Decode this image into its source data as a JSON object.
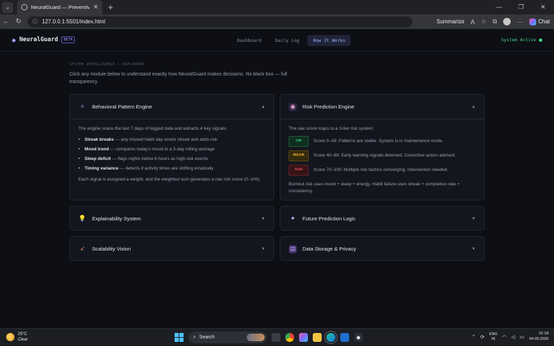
{
  "browser": {
    "tab_title": "NeuralGuard — Preventive Health",
    "url": "127.0.0.1:5501/index.html",
    "summarize_label": "Summarize",
    "chat_label": "Chat"
  },
  "app": {
    "brand": "NeuralGuard",
    "badge": "BETA",
    "nav": [
      "Dashboard",
      "Daily Log",
      "How It Works"
    ],
    "active_nav": "How It Works",
    "status": "System Active",
    "eyebrow": "SYSTEM INTELLIGENCE — EXPLAINED",
    "intro": "Click any module below to understand exactly how NeuralGuard makes decisions. No black box — full transparency."
  },
  "modules": {
    "behavioral": {
      "title": "Behavioral Pattern Engine",
      "icon": "sparkle-icon",
      "intro": "The engine scans the last 7 days of logged data and extracts 4 key signals:",
      "signals": [
        {
          "name": "Streak breaks",
          "desc": " — any missed habit day resets streak and adds risk"
        },
        {
          "name": "Mood trend",
          "desc": " — compares today's mood to a 3-day rolling average"
        },
        {
          "name": "Sleep deficit",
          "desc": " — flags nights below 6 hours as high-risk events"
        },
        {
          "name": "Timing variance",
          "desc": " — detects if activity times are shifting erratically"
        }
      ],
      "outro": "Each signal is assigned a weight, and the weighted sum generates a raw risk score (0–100)."
    },
    "risk": {
      "title": "Risk Prediction Engine",
      "icon": "gauge-icon",
      "intro": "The raw score maps to a 3-tier risk system:",
      "tiers": [
        {
          "badge": "LOW",
          "text": "Score 0–39: Patterns are stable. System is in maintenance mode."
        },
        {
          "badge": "MEDIUM",
          "text": "Score 40–69: Early warning signals detected. Corrective action advised."
        },
        {
          "badge": "HIGH",
          "text": "Score 70–100: Multiple risk factors converging. Intervention needed."
        }
      ],
      "outro": "Burnout risk uses mood + sleep + energy. Habit failure uses streak + completion rate + consistency."
    },
    "explainability": {
      "title": "Explainability System",
      "icon": "lightbulb-icon"
    },
    "future": {
      "title": "Future Prediction Logic",
      "icon": "crystal-ball-icon"
    },
    "scalability": {
      "title": "Scalability Vision",
      "icon": "rocket-icon"
    },
    "storage": {
      "title": "Data Storage & Privacy",
      "icon": "lock-icon"
    }
  },
  "taskbar": {
    "temp": "25°C",
    "weather": "Clear",
    "search_label": "Search",
    "lang1": "ENG",
    "lang2": "IN",
    "time": "01:18",
    "date": "04-05-2026"
  },
  "colors": {
    "accent": "#aab0ff",
    "status_green": "#45d483",
    "low": "#3ed482",
    "medium": "#f2b533",
    "high": "#f05a63"
  }
}
